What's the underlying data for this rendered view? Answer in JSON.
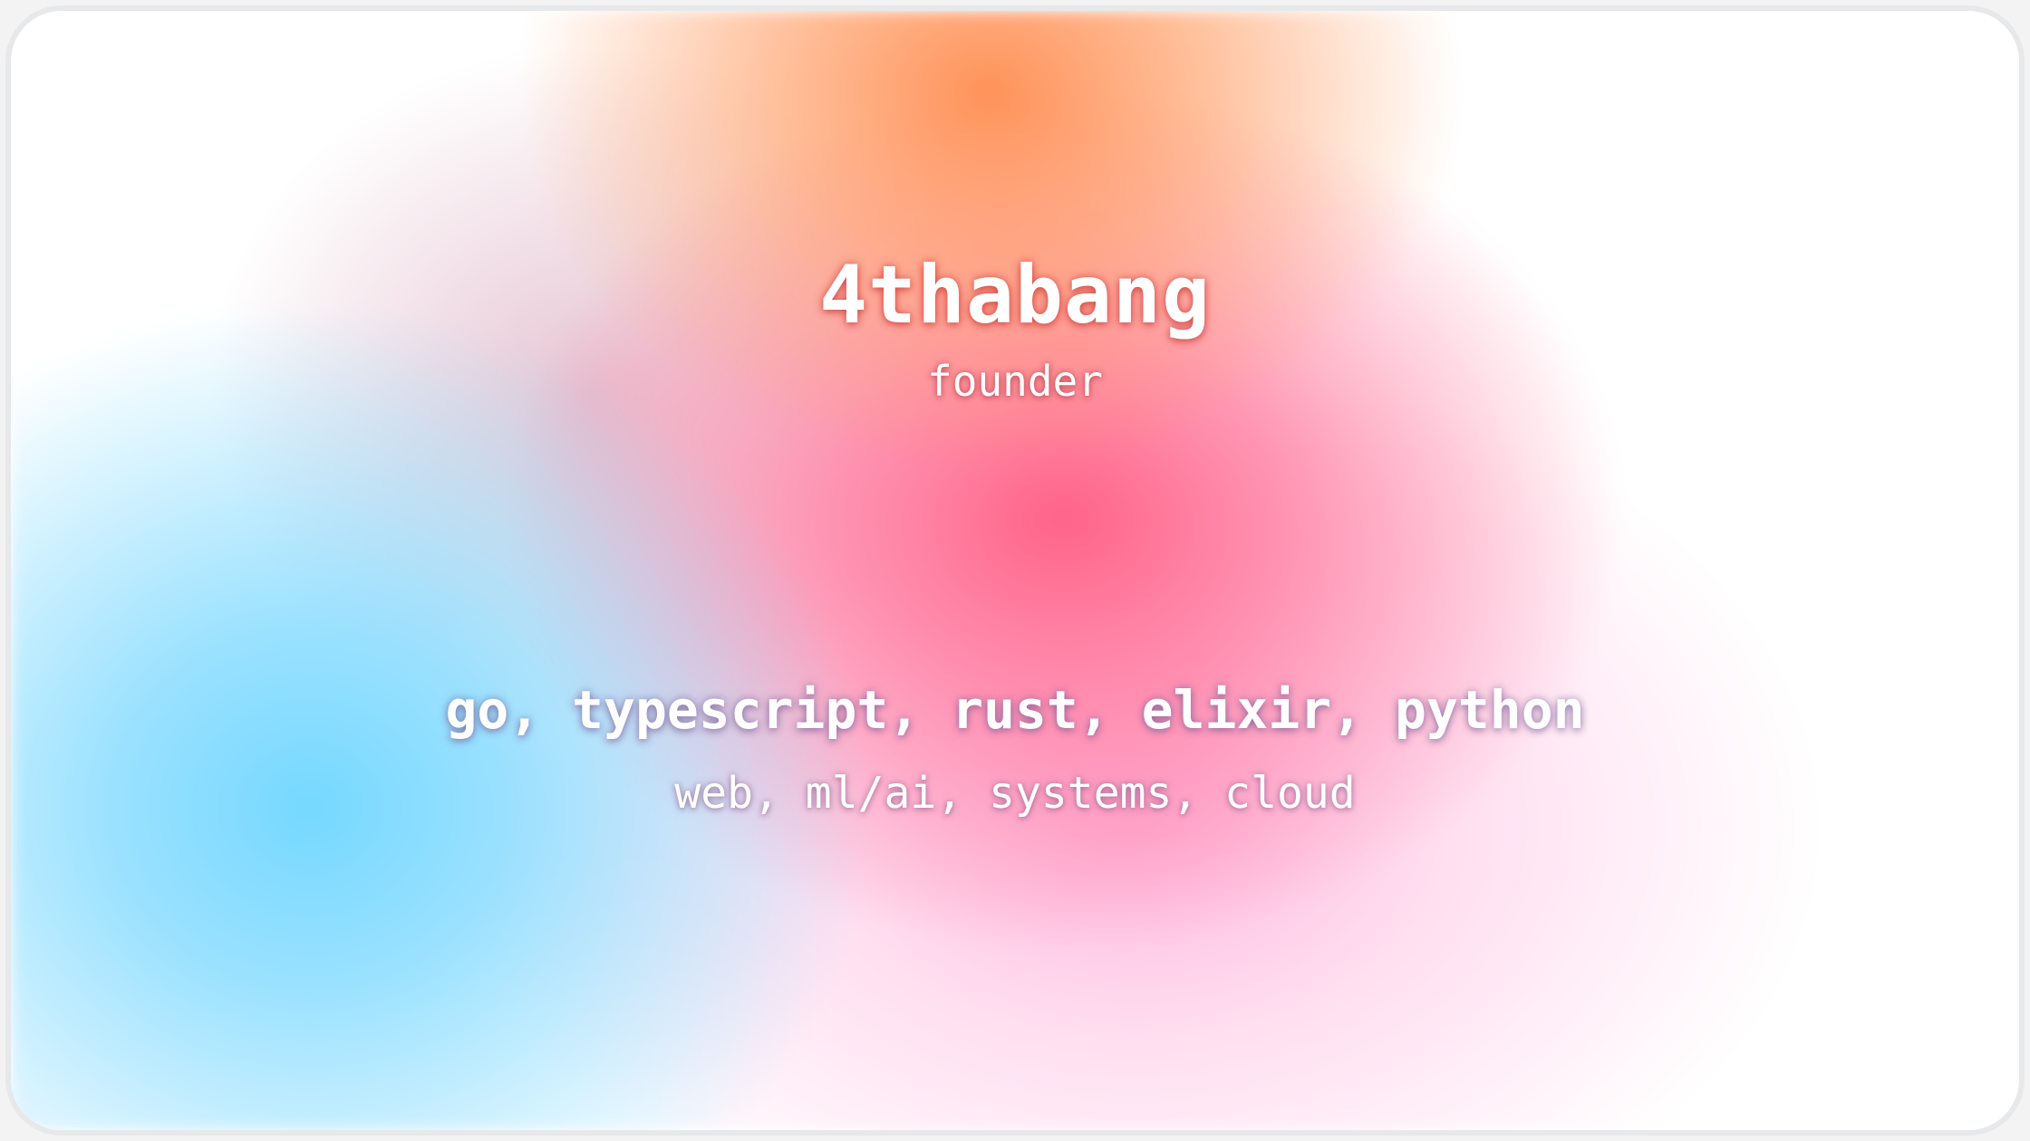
{
  "profile": {
    "name": "4thabang",
    "role": "founder",
    "languages": "go, typescript, rust, elixir, python",
    "domains": "web, ml/ai, systems, cloud"
  },
  "colors": {
    "background_card": "#ffffff",
    "border": "#e7e8ea",
    "gradient_blue": "#6ed6ff",
    "gradient_orange": "#ff8c50",
    "gradient_red_pink": "#ff5c82",
    "gradient_light_pink": "#ffaad7",
    "text": "#ffffff"
  }
}
